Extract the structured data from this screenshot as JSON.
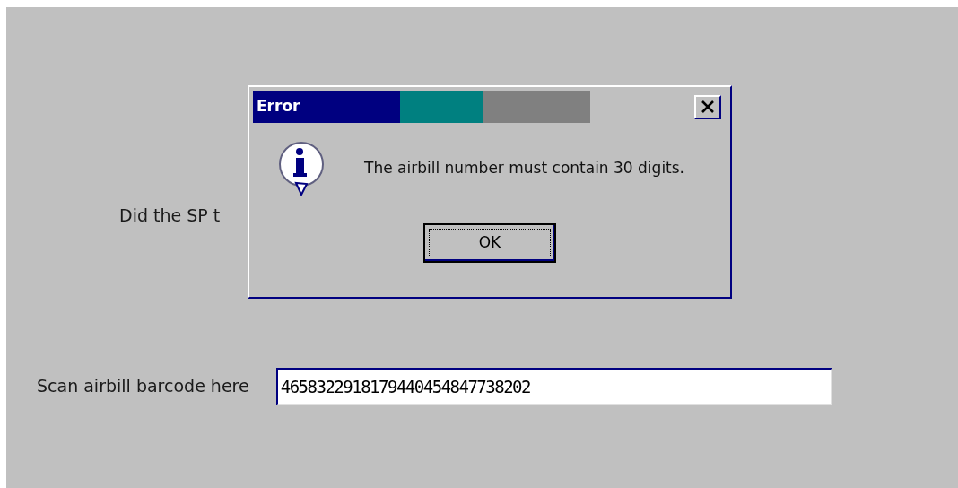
{
  "form": {
    "question": "Did the SP t",
    "scan_label": "Scan airbill barcode here",
    "scan_value": "4658322918179440454847738202"
  },
  "dialog": {
    "title": "Error",
    "message": "The airbill number must contain 30 digits.",
    "buttons": [
      {
        "label": "OK",
        "focused": true
      }
    ]
  }
}
